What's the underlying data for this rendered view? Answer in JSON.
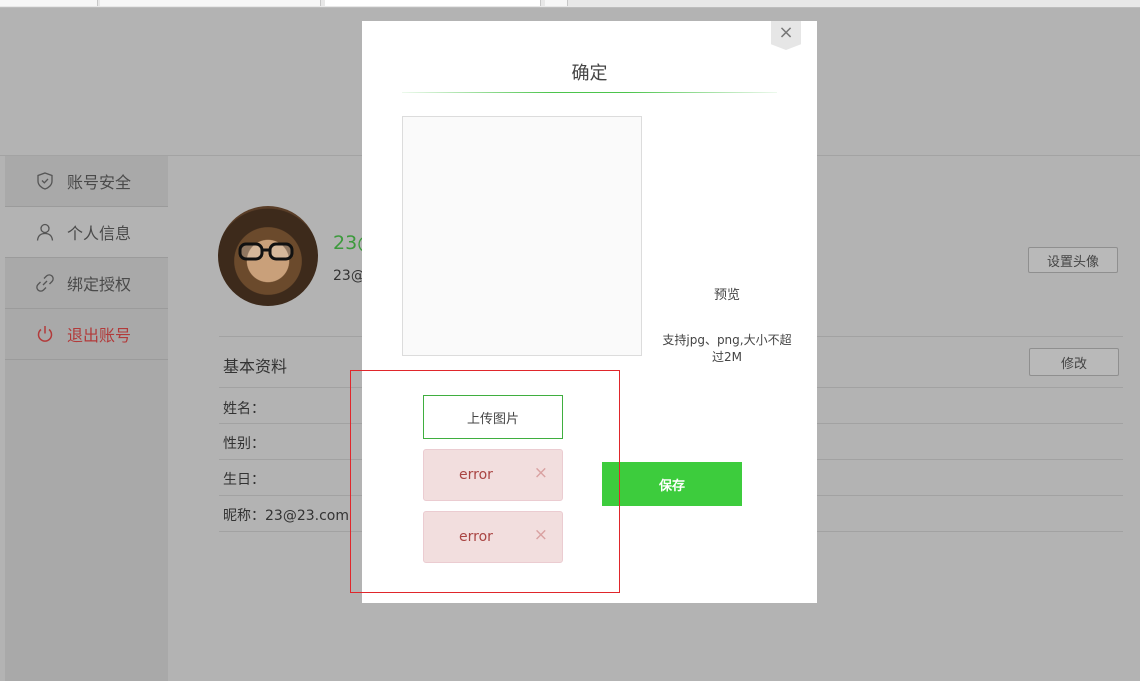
{
  "sidebar": {
    "items": [
      {
        "label": "账号安全",
        "icon": "shield-icon"
      },
      {
        "label": "个人信息",
        "icon": "user-icon"
      },
      {
        "label": "绑定授权",
        "icon": "link-icon"
      },
      {
        "label": "退出账号",
        "icon": "power-icon"
      }
    ]
  },
  "profile": {
    "username_partial": "23@",
    "email_partial": "23@",
    "set_avatar_label": "设置头像",
    "section_title": "基本资料",
    "edit_label": "修改",
    "fields": [
      {
        "label": "姓名："
      },
      {
        "label": "性别："
      },
      {
        "label": "生日："
      },
      {
        "label": "昵称：23@23.com"
      }
    ]
  },
  "modal": {
    "title": "确定",
    "close_glyph": "×",
    "preview_label": "预览",
    "support_text": "支持jpg、png,大小不超过2M",
    "upload_label": "上传图片",
    "errors": [
      {
        "text": "error",
        "close_glyph": "×"
      },
      {
        "text": "error",
        "close_glyph": "×"
      }
    ],
    "save_label": "保存"
  },
  "colors": {
    "accent_green": "#3dcc3d",
    "error_bg": "#f2dede",
    "error_text": "#a94442",
    "logout_red": "#b23a3a",
    "highlight_red": "#e0262b"
  }
}
